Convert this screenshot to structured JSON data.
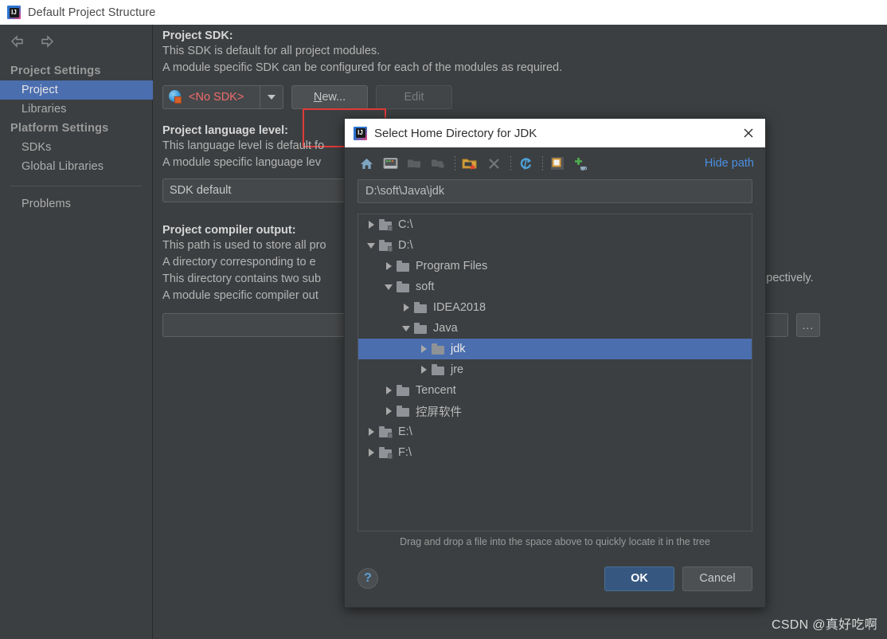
{
  "window": {
    "title": "Default Project Structure",
    "logo_icon": "intellij-idea-icon"
  },
  "sidebar": {
    "back_icon": "arrow-left-icon",
    "forward_icon": "arrow-right-icon",
    "groups": [
      {
        "label": "Project Settings",
        "items": [
          {
            "label": "Project",
            "selected": true
          },
          {
            "label": "Libraries",
            "selected": false
          }
        ]
      },
      {
        "label": "Platform Settings",
        "items": [
          {
            "label": "SDKs",
            "selected": false
          },
          {
            "label": "Global Libraries",
            "selected": false
          }
        ]
      }
    ],
    "extra_items": [
      {
        "label": "Problems"
      }
    ]
  },
  "main": {
    "sdk": {
      "label": "Project SDK:",
      "desc1": "This SDK is default for all project modules.",
      "desc2": "A module specific SDK can be configured for each of the modules as required.",
      "combo_value": "<No SDK>",
      "combo_icon": "sdk-globe-icon",
      "combo_arrow_icon": "chevron-down-icon",
      "new_button": "New...",
      "new_button_mnemonic": "N",
      "edit_button": "Edit",
      "focus_ring_color": "#e03a3a",
      "value_color": "#ef6b6b"
    },
    "language_level": {
      "label": "Project language level:",
      "desc1": "This language level is default fo",
      "desc2": "A module specific language lev",
      "value": "SDK default"
    },
    "compiler_output": {
      "label": "Project compiler output:",
      "desc1": "This path is used to store all pro",
      "desc2": "A directory corresponding to e",
      "desc3": "This directory contains two sub",
      "desc4": "A module specific compiler out",
      "desc_tail": "spectively.",
      "value": "",
      "browse_button": "...",
      "browse_icon": "ellipsis-icon"
    }
  },
  "dialog": {
    "title": "Select Home Directory for JDK",
    "logo_icon": "intellij-idea-icon",
    "close_icon": "close-icon",
    "toolbar": [
      {
        "name": "home-icon",
        "glyph": "home"
      },
      {
        "name": "desktop-icon",
        "glyph": "desktop"
      },
      {
        "name": "project-folder-icon",
        "glyph": "folder-dim"
      },
      {
        "name": "module-folder-icon",
        "glyph": "folder-dim2"
      },
      {
        "name": "new-folder-icon",
        "glyph": "folder-new"
      },
      {
        "name": "delete-icon",
        "glyph": "x"
      },
      {
        "name": "refresh-icon",
        "glyph": "refresh"
      },
      {
        "name": "show-hidden-icon",
        "glyph": "hidden"
      },
      {
        "name": "add-jdk-icon",
        "glyph": "add-java"
      }
    ],
    "hide_path_label": "Hide path",
    "path_value": "D:\\soft\\Java\\jdk",
    "tree": [
      {
        "label": "C:\\",
        "depth": 0,
        "state": "collapsed",
        "kind": "drive",
        "selected": false
      },
      {
        "label": "D:\\",
        "depth": 0,
        "state": "expanded",
        "kind": "drive",
        "selected": false
      },
      {
        "label": "Program Files",
        "depth": 1,
        "state": "collapsed",
        "kind": "folder",
        "selected": false
      },
      {
        "label": "soft",
        "depth": 1,
        "state": "expanded",
        "kind": "folder",
        "selected": false
      },
      {
        "label": "IDEA2018",
        "depth": 2,
        "state": "collapsed",
        "kind": "folder",
        "selected": false
      },
      {
        "label": "Java",
        "depth": 2,
        "state": "expanded",
        "kind": "folder",
        "selected": false
      },
      {
        "label": "jdk",
        "depth": 3,
        "state": "collapsed",
        "kind": "folder",
        "selected": true
      },
      {
        "label": "jre",
        "depth": 3,
        "state": "collapsed",
        "kind": "folder",
        "selected": false
      },
      {
        "label": "Tencent",
        "depth": 1,
        "state": "collapsed",
        "kind": "folder",
        "selected": false
      },
      {
        "label": "控屏软件",
        "depth": 1,
        "state": "collapsed",
        "kind": "folder",
        "selected": false
      },
      {
        "label": "E:\\",
        "depth": 0,
        "state": "collapsed",
        "kind": "drive",
        "selected": false
      },
      {
        "label": "F:\\",
        "depth": 0,
        "state": "collapsed",
        "kind": "drive",
        "selected": false
      }
    ],
    "hint": "Drag and drop a file into the space above to quickly locate it in the tree",
    "help_icon": "help-icon",
    "help_label": "?",
    "ok_label": "OK",
    "cancel_label": "Cancel",
    "selection_color": "#4b6eaf",
    "primary_color": "#365880"
  },
  "watermark": {
    "text": "CSDN @真好吃啊"
  }
}
